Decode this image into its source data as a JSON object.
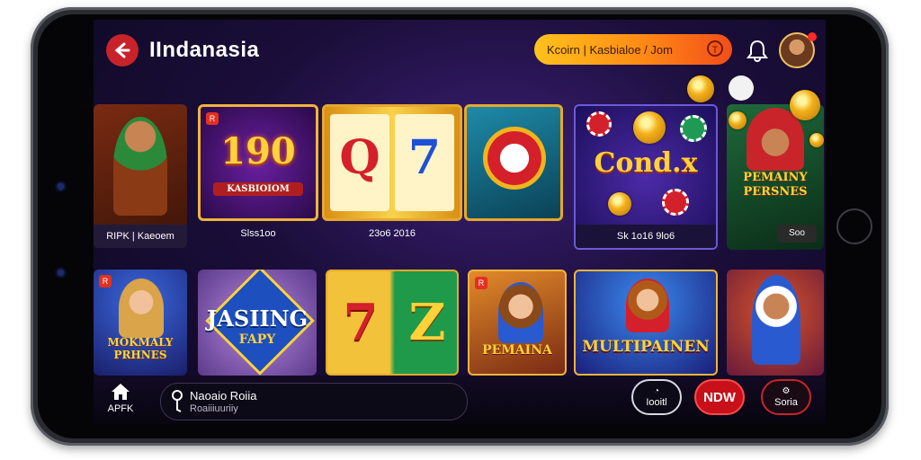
{
  "header": {
    "title": "IIndanasia",
    "search_text": "Kcoirn | Kasbialoe / Jom",
    "close_symbol": "T"
  },
  "row1": [
    {
      "caption": "RIPK | Kaeoem"
    },
    {
      "art": "190",
      "subart": "KASBIOIOM",
      "caption": "Slss1oo"
    },
    {
      "caption": "23o6 2016",
      "reel_a": "Q",
      "reel_b": "7"
    },
    {
      "art": "Cond.x",
      "caption": "Sk 1o16 9lo6"
    },
    {
      "art": "PEMAINY PERSNES",
      "caption": "Soo"
    }
  ],
  "row2": [
    {
      "art": "MOKMALY PRHNES"
    },
    {
      "art": "JASIING",
      "subart": "FAPY"
    },
    {
      "reel_a": "7",
      "reel_b": "Z"
    },
    {
      "art": "PEMAINA"
    },
    {
      "art": "MULTIPAINEN"
    },
    {
      "art": ""
    }
  ],
  "bottom": {
    "home_label": "APFK",
    "player_title": "Naoaio Roiia",
    "player_sub": "Roaiiiuuriiy",
    "btn_left": "Iooitl",
    "btn_mid": "NDW",
    "btn_right": "Soria"
  },
  "tag_symbol": "R"
}
